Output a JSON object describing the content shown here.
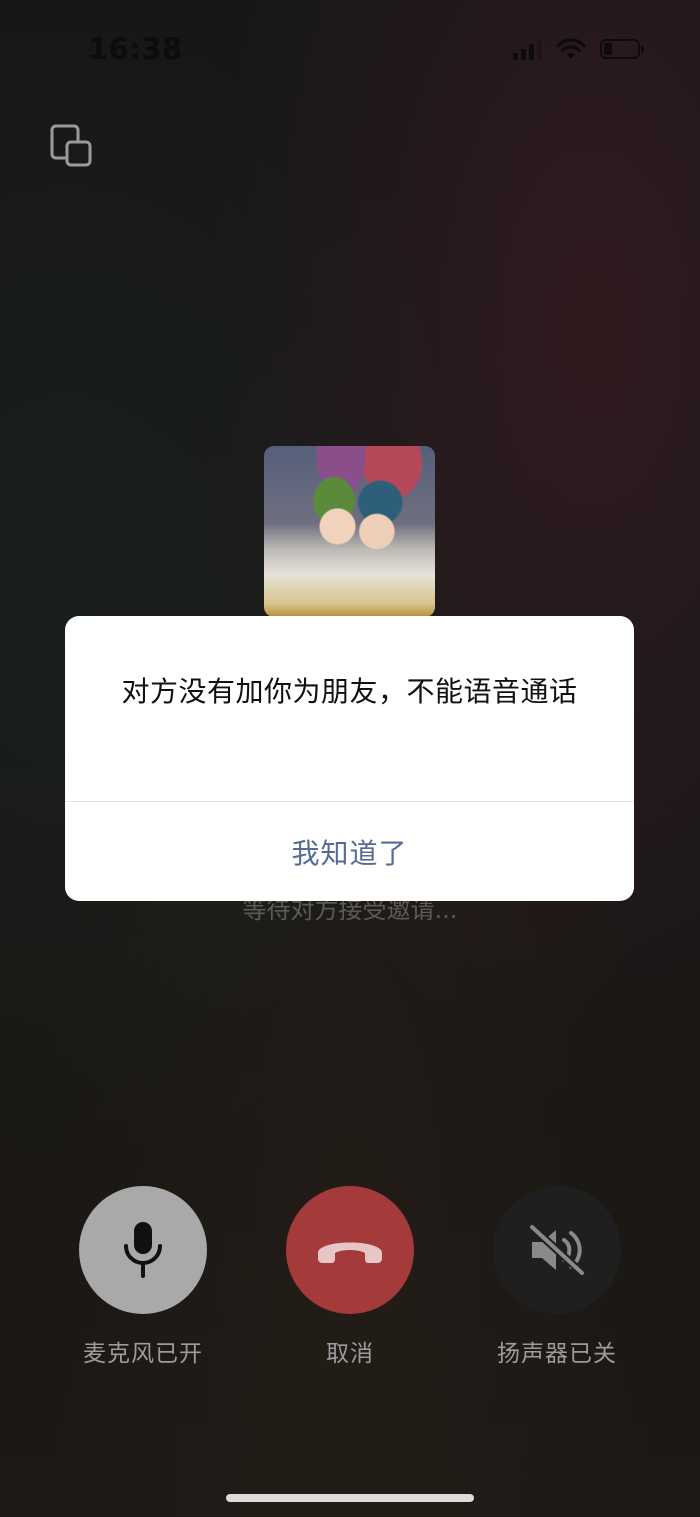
{
  "status_bar": {
    "time": "16:38",
    "signal_icon": "cellular-signal-icon",
    "wifi_icon": "wifi-icon",
    "battery_icon": "battery-icon",
    "battery_level": 0.25
  },
  "top_bar": {
    "float_window_icon": "picture-in-picture-icon"
  },
  "call": {
    "waiting_text": "等待对方接受邀请..."
  },
  "dialog": {
    "message": "对方没有加你为朋友，不能语音通话",
    "button_label": "我知道了",
    "button_color": "#576b95"
  },
  "controls": {
    "mic": {
      "label": "麦克风已开",
      "icon": "microphone-icon"
    },
    "cancel": {
      "label": "取消",
      "icon": "hang-up-phone-icon",
      "color": "#a53a3a"
    },
    "speaker": {
      "label": "扬声器已关",
      "icon": "speaker-muted-icon"
    }
  }
}
